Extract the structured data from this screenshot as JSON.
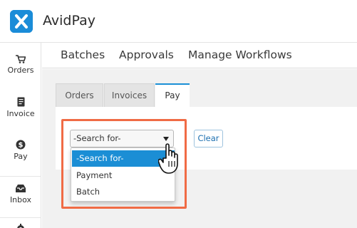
{
  "app": {
    "title": "AvidPay",
    "brand_color": "#1a8cd8",
    "highlight_color": "#f06b45"
  },
  "sidebar": {
    "items": [
      {
        "label": "Orders",
        "icon": "cart-icon"
      },
      {
        "label": "Invoice",
        "icon": "document-icon"
      },
      {
        "label": "Pay",
        "icon": "dollar-circle-icon"
      },
      {
        "label": "Inbox",
        "icon": "inbox-icon"
      },
      {
        "label": "",
        "icon": "gear-icon"
      }
    ]
  },
  "topnav": {
    "items": [
      "Batches",
      "Approvals",
      "Manage Workflows"
    ]
  },
  "tabs": {
    "items": [
      "Orders",
      "Invoices",
      "Pay"
    ],
    "active": "Pay"
  },
  "search": {
    "selected": "-Search for-",
    "options": [
      "-Search for-",
      "Payment",
      "Batch"
    ],
    "clear_label": "Clear"
  }
}
